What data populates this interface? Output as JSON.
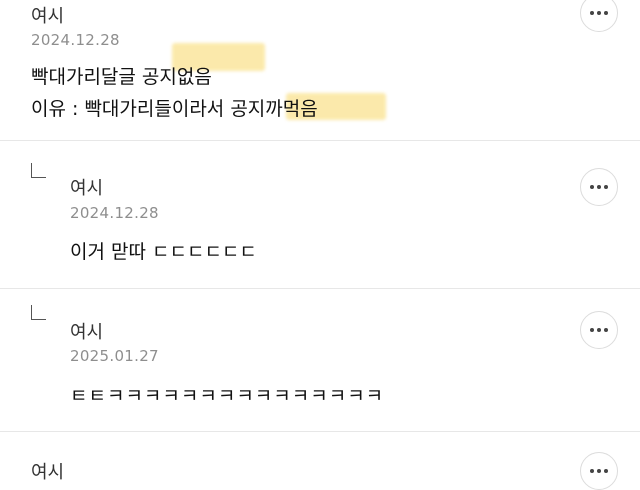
{
  "comments": [
    {
      "author": "여시",
      "date": "2024.12.28",
      "lines": [
        "빡대가리달글 공지없음",
        "이유 : 빡대가리들이라서 공지까먹음"
      ]
    },
    {
      "author": "여시",
      "date": "2024.12.28",
      "lines": [
        "이거 맏따 ㄷㄷㄷㄷㄷㄷ"
      ],
      "is_reply": true
    },
    {
      "author": "여시",
      "date": "2025.01.27",
      "lines": [
        "ㅌㅌㅋㅋㅋㅋㅋㅋㅋㅋㅋㅋㅋㅋㅋㅋㅋ"
      ],
      "is_reply": true
    },
    {
      "author": "여시"
    }
  ],
  "icons": {
    "more": "more-horizontal-icon",
    "reply": "reply-arrow-icon"
  },
  "colors": {
    "highlight": "#fbe7a2",
    "date": "#8e8e8e"
  }
}
